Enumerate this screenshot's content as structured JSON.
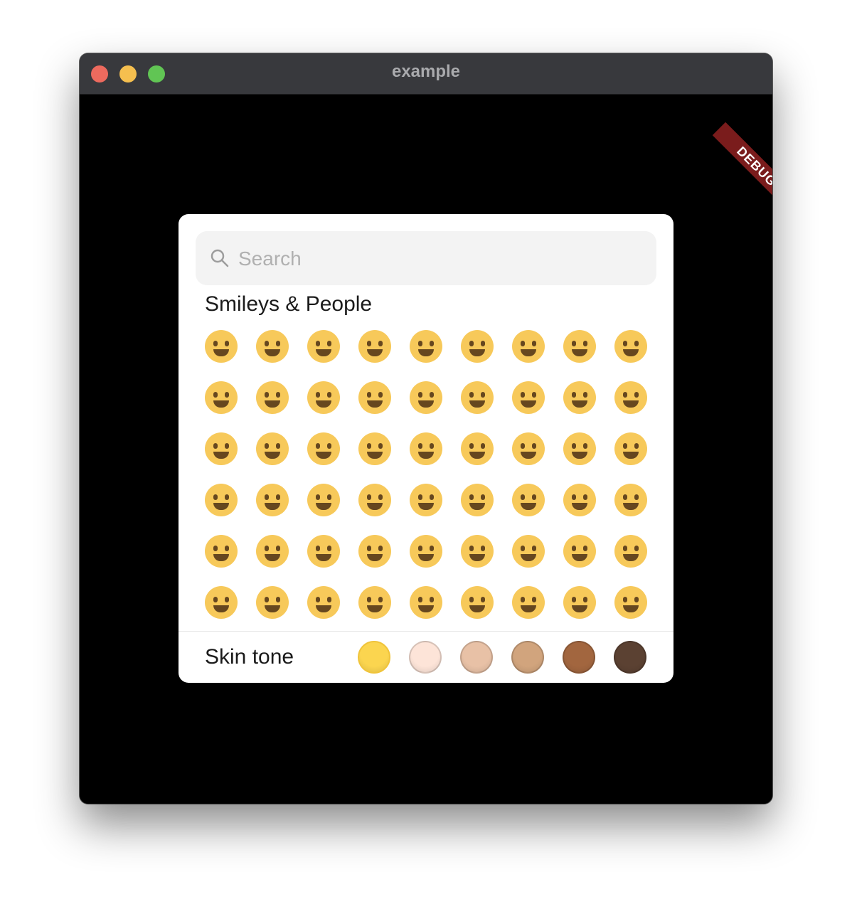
{
  "window": {
    "title": "example"
  },
  "debug_banner": "DEBUG",
  "search": {
    "placeholder": "Search"
  },
  "category": {
    "title": "Smileys & People"
  },
  "emojis": [
    "😀",
    "😃",
    "😄",
    "😁",
    "😆",
    "😅",
    "🤣",
    "😂",
    "🙂",
    "🙃",
    "🫠",
    "😉",
    "😊",
    "😇",
    "🥰",
    "😍",
    "🤩",
    "😘",
    "😗",
    "☺️",
    "😚",
    "😙",
    "🥲",
    "😋",
    "😛",
    "😜",
    "🤪",
    "😝",
    "🤑",
    "🤗",
    "🤭",
    "🫢",
    "🫣",
    "🤫",
    "🤔",
    "🫡",
    "🤐",
    "🤨",
    "😐",
    "😑",
    "😶",
    "🫥",
    "😶‍🌫️",
    "😏",
    "😒",
    "🙄",
    "😬",
    "😮‍💨",
    "🤥",
    "😌",
    "😔",
    "😪",
    "🤤",
    "😴"
  ],
  "skin_tone": {
    "label": "Skin tone",
    "tones": [
      "#fbd54f",
      "#fde4d8",
      "#e8c1a6",
      "#d1a47d",
      "#a2663f",
      "#5b4132"
    ]
  }
}
